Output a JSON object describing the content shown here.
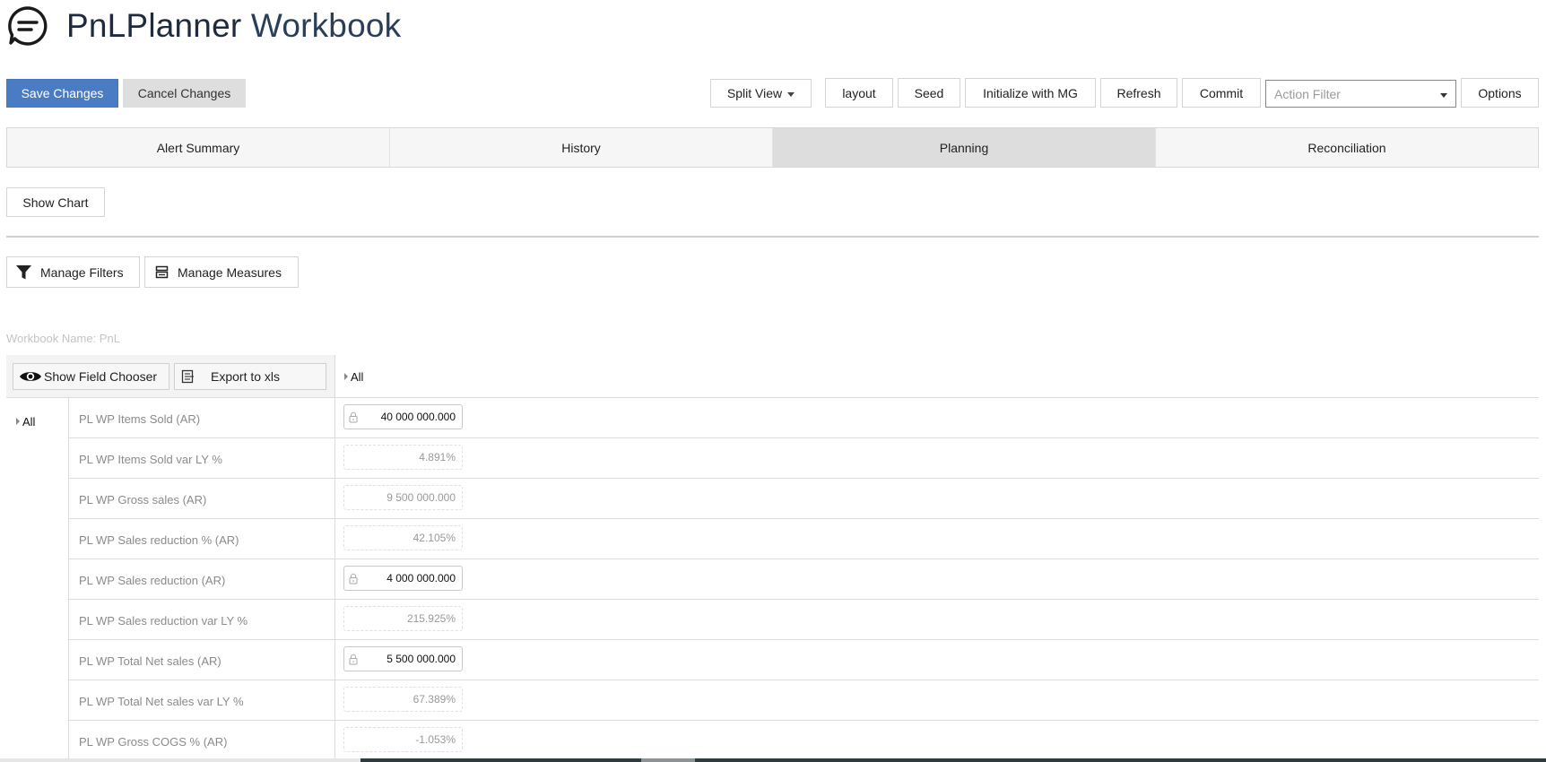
{
  "app": {
    "title_main": "PnLPlanner",
    "title_sub": "Workbook",
    "logo_icon": "chat-bubble-icon"
  },
  "toolbar": {
    "save_label": "Save Changes",
    "cancel_label": "Cancel Changes",
    "split_view_label": "Split View",
    "layout_label": "layout",
    "seed_label": "Seed",
    "initialize_label": "Initialize with MG",
    "refresh_label": "Refresh",
    "commit_label": "Commit",
    "action_filter_placeholder": "Action Filter",
    "options_label": "Options"
  },
  "tabs": [
    {
      "label": "Alert Summary",
      "active": false
    },
    {
      "label": "History",
      "active": false
    },
    {
      "label": "Planning",
      "active": true
    },
    {
      "label": "Reconciliation",
      "active": false
    }
  ],
  "show_chart_label": "Show Chart",
  "filters": {
    "manage_filters_label": "Manage Filters",
    "manage_measures_label": "Manage Measures"
  },
  "workbook_name": "Workbook Name: PnL",
  "grid": {
    "show_field_chooser_label": "Show Field Chooser",
    "export_label": "Export to xls",
    "column_header": "All",
    "row_header": "All",
    "rows": [
      {
        "measure": "PL WP Items Sold (AR)",
        "value": "40 000 000.000",
        "editable": true
      },
      {
        "measure": "PL WP Items Sold var LY %",
        "value": "4.891%",
        "editable": false
      },
      {
        "measure": "PL WP Gross sales (AR)",
        "value": "9 500 000.000",
        "editable": false
      },
      {
        "measure": "PL WP Sales reduction % (AR)",
        "value": "42.105%",
        "editable": false
      },
      {
        "measure": "PL WP Sales reduction (AR)",
        "value": "4 000 000.000",
        "editable": true
      },
      {
        "measure": "PL WP Sales reduction var LY %",
        "value": "215.925%",
        "editable": false
      },
      {
        "measure": "PL WP Total Net sales (AR)",
        "value": "5 500 000.000",
        "editable": true
      },
      {
        "measure": "PL WP Total Net sales var LY %",
        "value": "67.389%",
        "editable": false
      },
      {
        "measure": "PL WP Gross COGS % (AR)",
        "value": "-1.053%",
        "editable": false
      }
    ]
  },
  "colors": {
    "primary": "#4a7cc4",
    "active_tab": "#dddddd",
    "header_text": "#1f2a3c"
  }
}
